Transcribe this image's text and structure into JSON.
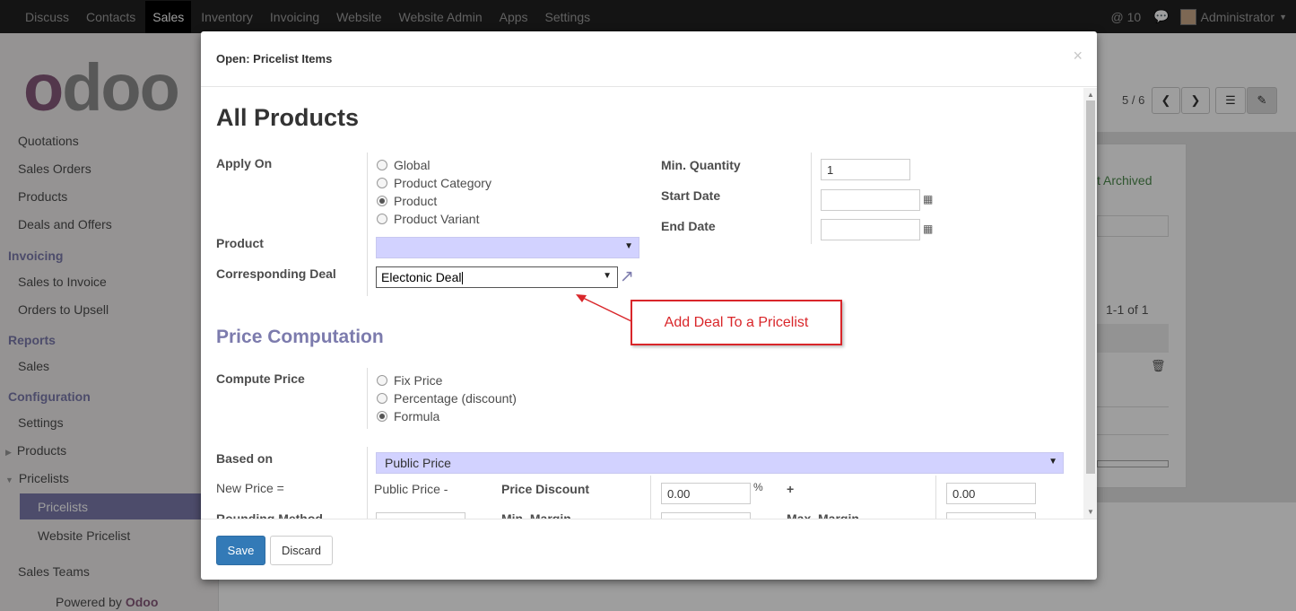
{
  "topbar": {
    "menu": [
      "Discuss",
      "Contacts",
      "Sales",
      "Inventory",
      "Invoicing",
      "Website",
      "Website Admin",
      "Apps",
      "Settings"
    ],
    "active": "Sales",
    "notifications": "@ 10",
    "user": "Administrator"
  },
  "sidebar": {
    "logo_left": "o",
    "logo_right": "doo",
    "items": {
      "quotations": "Quotations",
      "sales_orders": "Sales Orders",
      "products": "Products",
      "deals": "Deals and Offers",
      "invoicing_head": "Invoicing",
      "sales_to_invoice": "Sales to Invoice",
      "orders_to_upsell": "Orders to Upsell",
      "reports_head": "Reports",
      "sales": "Sales",
      "config_head": "Configuration",
      "settings": "Settings",
      "products_cfg": "Products",
      "pricelists": "Pricelists",
      "pricelists_sub": "Pricelists",
      "website_pricelist": "Website Pricelist",
      "sales_teams": "Sales Teams"
    },
    "powered_prefix": "Powered by",
    "powered_brand": "Odoo"
  },
  "background": {
    "pager": "5 / 6",
    "archived": "t Archived",
    "count": "1-1 of 1"
  },
  "modal": {
    "title": "Open: Pricelist Items",
    "close": "×",
    "heading": "All Products",
    "apply_on_label": "Apply On",
    "apply_on_options": [
      {
        "label": "Global",
        "checked": false
      },
      {
        "label": "Product Category",
        "checked": false
      },
      {
        "label": "Product",
        "checked": true
      },
      {
        "label": "Product Variant",
        "checked": false
      }
    ],
    "min_qty_label": "Min. Quantity",
    "min_qty_value": "1",
    "start_date_label": "Start Date",
    "end_date_label": "End Date",
    "product_label": "Product",
    "deal_label": "Corresponding Deal",
    "deal_value": "Electonic Deal",
    "price_computation": "Price Computation",
    "compute_price_label": "Compute Price",
    "compute_options": [
      {
        "label": "Fix Price",
        "checked": false
      },
      {
        "label": "Percentage (discount)",
        "checked": false
      },
      {
        "label": "Formula",
        "checked": true
      }
    ],
    "based_on_label": "Based on",
    "based_on_value": "Public Price",
    "new_price_label": "New Price =",
    "public_price_minus": "Public Price -",
    "price_discount_label": "Price Discount",
    "price_discount_value": "0.00",
    "percent": "%",
    "plus": "+",
    "surcharge_value": "0.00",
    "rounding_label": "Rounding Method",
    "min_margin_label": "Min. Margin",
    "max_margin_label": "Max. Margin",
    "save": "Save",
    "discard": "Discard"
  },
  "annotation": "Add Deal To a Pricelist",
  "colors": {
    "brand": "#875a7b",
    "accent": "#7c7bad",
    "primary": "#337ab7",
    "annotation": "#d9262a"
  }
}
